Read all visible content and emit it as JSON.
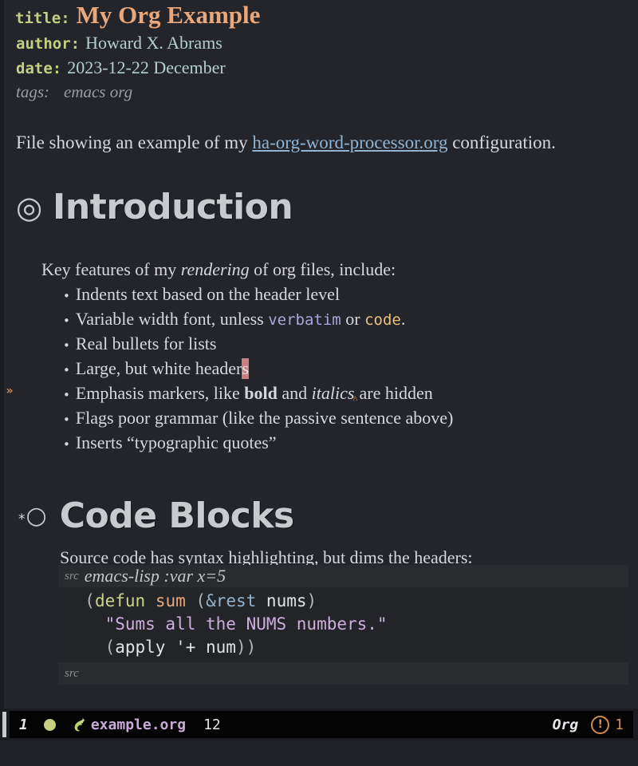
{
  "document": {
    "keywords": [
      {
        "key": "title:",
        "value": "My Org Example"
      },
      {
        "key": "author:",
        "value": "Howard X. Abrams"
      },
      {
        "key": "date:",
        "value": "2023-12-22 December"
      }
    ],
    "tags": {
      "key": "tags:",
      "value": "emacs org"
    },
    "intro": {
      "before_link": "File showing an example of my ",
      "link_text": "ha-org-word-processor.org",
      "after_link": " configuration."
    }
  },
  "sections": [
    {
      "bullet": "◎",
      "title": "Introduction",
      "lead_in": {
        "before_italic": "Key features of my ",
        "italic": "rendering",
        "after_italic": " of org files, include:"
      },
      "bullets": [
        {
          "dot": "•",
          "text": "Indents text based on the header level"
        },
        {
          "dot": "•",
          "prefix": "Variable width font, unless ",
          "verbatim": "verbatim",
          "middle": " or ",
          "code": "code",
          "suffix": "."
        },
        {
          "dot": "•",
          "text": "Real bullets for lists"
        },
        {
          "dot": "•",
          "prefix": "Large, but white header",
          "cursor_char": "s"
        },
        {
          "dot": "•",
          "prefix": "Emphasis markers, like ",
          "bold": "bold",
          "middle": " and ",
          "italic": "italics",
          "suffix": "are hidden"
        },
        {
          "dot": "•",
          "text": "Flags poor grammar (like the passive sentence above)"
        },
        {
          "dot": "•",
          "text": "Inserts “typographic quotes”"
        }
      ]
    },
    {
      "star": "*",
      "bullet": "○",
      "title": "Code Blocks",
      "lead_in_text": "Source code has syntax highlighting, but dims the headers:"
    }
  ],
  "src_block": {
    "begin_keyword": "src",
    "header_args": "emacs-lisp :var x=5",
    "end_keyword": "src",
    "lines": [
      {
        "indent": "  ",
        "tokens": [
          {
            "t": "(",
            "c": "paren"
          },
          {
            "t": "defun",
            "c": "defun"
          },
          {
            "t": " ",
            "c": "var"
          },
          {
            "t": "sum",
            "c": "fname"
          },
          {
            "t": " ",
            "c": "var"
          },
          {
            "t": "(",
            "c": "paren"
          },
          {
            "t": "&rest",
            "c": "arg"
          },
          {
            "t": " ",
            "c": "var"
          },
          {
            "t": "nums",
            "c": "var"
          },
          {
            "t": ")",
            "c": "paren"
          }
        ]
      },
      {
        "indent": "    ",
        "tokens": [
          {
            "t": "\"Sums all the NUMS numbers.\"",
            "c": "string"
          }
        ]
      },
      {
        "indent": "    ",
        "tokens": [
          {
            "t": "(",
            "c": "paren"
          },
          {
            "t": "apply",
            "c": "var"
          },
          {
            "t": " ",
            "c": "var"
          },
          {
            "t": "'+",
            "c": "var"
          },
          {
            "t": " ",
            "c": "var"
          },
          {
            "t": "num",
            "c": "var"
          },
          {
            "t": "))",
            "c": "paren"
          }
        ]
      }
    ]
  },
  "modeline": {
    "window_number": "1",
    "status_dot": "●",
    "gnu_icon": "gnu-icon",
    "buffer_name": "example.org",
    "position": "12",
    "major_mode": "Org",
    "error_icon": "!",
    "error_count": "1"
  },
  "colors": {
    "background": "#24252a",
    "frame_background": "#1b1c20",
    "minibuffer_background": "#212227",
    "keyword": "#c3d082",
    "title_value": "#e8a87c",
    "meta_value": "#b5cfcb",
    "tag": "#9b9ca0",
    "body_text": "#d7d8dc",
    "link": "#8fb4d4",
    "heading": "#c9cace",
    "verbatim": "#a8a6de",
    "inline_code": "#e8c07a",
    "cursor": "#c97f7f",
    "fringe_arrow": "#d08b50",
    "src_header_bg": "#2a2b2f",
    "src_body_bg": "#232428",
    "modeline_bg": "#030303",
    "buffer_name_color": "#c9a9d8",
    "error_color": "#d08b50"
  }
}
